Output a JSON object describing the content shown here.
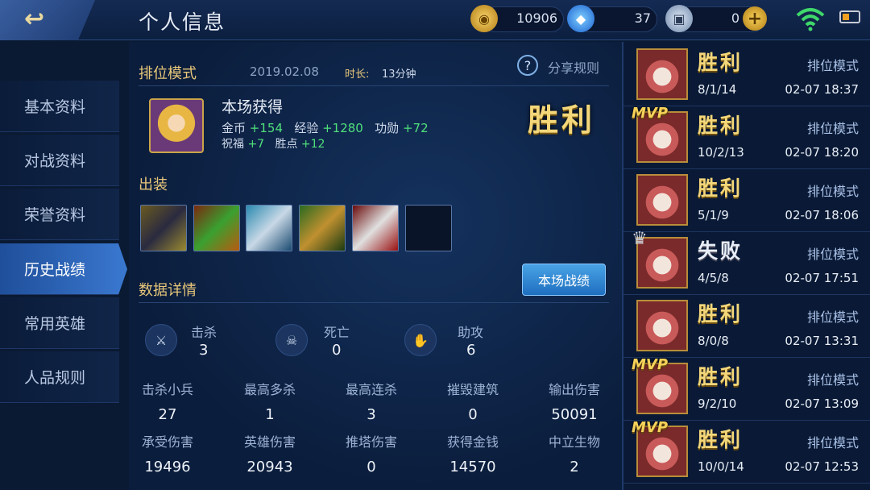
{
  "header": {
    "back_icon": "back-arrow-icon",
    "title": "个人信息",
    "gold": "10906",
    "diamonds": "37",
    "vouchers": "0",
    "add_icon": "plus-icon"
  },
  "sidebar": {
    "items": [
      {
        "label": "基本资料"
      },
      {
        "label": "对战资料"
      },
      {
        "label": "荣誉资料"
      },
      {
        "label": "历史战绩"
      },
      {
        "label": "常用英雄"
      },
      {
        "label": "人品规则"
      }
    ],
    "active_index": 3
  },
  "match": {
    "mode": "排位模式",
    "date": "2019.02.08",
    "duration_label": "时长:",
    "duration": "13分钟",
    "share_rules": "分享规则",
    "gains_title": "本场获得",
    "gold_label": "金币",
    "gold_value": "+154",
    "exp_label": "经验",
    "exp_value": "+1280",
    "merit_label": "功勋",
    "merit_value": "+72",
    "bless_label": "祝福",
    "bless_value": "+7",
    "points_label": "胜点",
    "points_value": "+12",
    "result": "胜利",
    "equipment_label": "出装",
    "details_label": "数据详情",
    "match_stats_button": "本场战绩"
  },
  "kda": [
    {
      "label": "击杀",
      "value": "3",
      "icon": "kill-icon"
    },
    {
      "label": "死亡",
      "value": "0",
      "icon": "skull-icon"
    },
    {
      "label": "助攻",
      "value": "6",
      "icon": "assist-icon"
    }
  ],
  "stats_grid": [
    {
      "label": "击杀小兵",
      "value": "27"
    },
    {
      "label": "最高多杀",
      "value": "1"
    },
    {
      "label": "最高连杀",
      "value": "3"
    },
    {
      "label": "摧毁建筑",
      "value": "0"
    },
    {
      "label": "输出伤害",
      "value": "50091"
    },
    {
      "label": "承受伤害",
      "value": "19496"
    },
    {
      "label": "英雄伤害",
      "value": "20943"
    },
    {
      "label": "推塔伤害",
      "value": "0"
    },
    {
      "label": "获得金钱",
      "value": "14570"
    },
    {
      "label": "中立生物",
      "value": "2"
    }
  ],
  "history": [
    {
      "result": "胜利",
      "mode": "排位模式",
      "kda": "8/1/14",
      "time": "02-07 18:37",
      "badge": ""
    },
    {
      "result": "胜利",
      "mode": "排位模式",
      "kda": "10/2/13",
      "time": "02-07 18:20",
      "badge": "MVP"
    },
    {
      "result": "胜利",
      "mode": "排位模式",
      "kda": "5/1/9",
      "time": "02-07 18:06",
      "badge": ""
    },
    {
      "result": "失败",
      "mode": "排位模式",
      "kda": "4/5/8",
      "time": "02-07 17:51",
      "badge": "crown"
    },
    {
      "result": "胜利",
      "mode": "排位模式",
      "kda": "8/0/8",
      "time": "02-07 13:31",
      "badge": ""
    },
    {
      "result": "胜利",
      "mode": "排位模式",
      "kda": "9/2/10",
      "time": "02-07 13:09",
      "badge": "MVP"
    },
    {
      "result": "胜利",
      "mode": "排位模式",
      "kda": "10/0/14",
      "time": "02-07 12:53",
      "badge": "MVP"
    }
  ],
  "colors": {
    "accent_gold": "#f3d77a",
    "gain_green": "#4fe07a",
    "active_tab": "#3a78d0"
  }
}
